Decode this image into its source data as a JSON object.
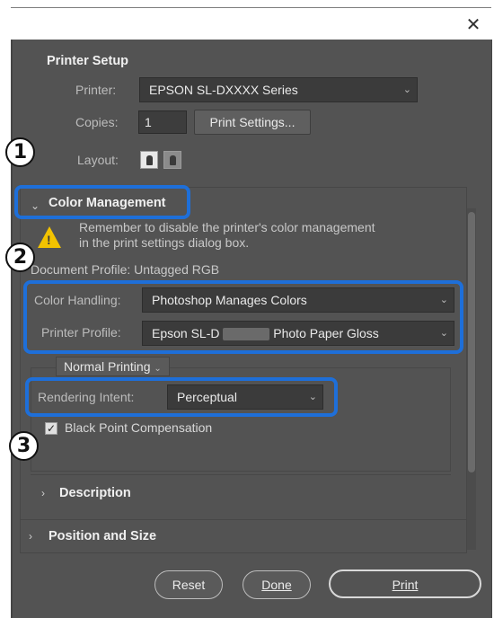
{
  "window": {
    "close_glyph": "✕"
  },
  "printer_setup": {
    "title": "Printer Setup",
    "printer_label": "Printer:",
    "printer_value": "EPSON SL-DXXXX Series",
    "copies_label": "Copies:",
    "copies_value": "1",
    "print_settings_button": "Print Settings...",
    "layout_label": "Layout:",
    "layout_icons": [
      "portrait-layout-icon",
      "landscape-layout-icon"
    ]
  },
  "color_management": {
    "title": "Color Management",
    "warning_text": "Remember to disable the printer's color management in the print settings dialog box.",
    "document_profile": "Document Profile: Untagged RGB",
    "color_handling_label": "Color Handling:",
    "color_handling_value": "Photoshop Manages Colors",
    "printer_profile_label": "Printer Profile:",
    "printer_profile_value_left": "Epson SL-D",
    "printer_profile_value_right": "Photo Paper Gloss",
    "mode_tab": "Normal Printing",
    "rendering_intent_label": "Rendering Intent:",
    "rendering_intent_value": "Perceptual",
    "black_point_label": "Black Point Compensation",
    "black_point_checked": true
  },
  "sections": {
    "description": "Description",
    "position_size": "Position and Size"
  },
  "buttons": {
    "reset": "Reset",
    "done": "Done",
    "print": "Print"
  },
  "callouts": [
    "1",
    "2",
    "3"
  ],
  "colors": {
    "callout_blue": "#1e6fd9",
    "dialog_bg": "#535353",
    "warning_yellow": "#f2c200"
  }
}
